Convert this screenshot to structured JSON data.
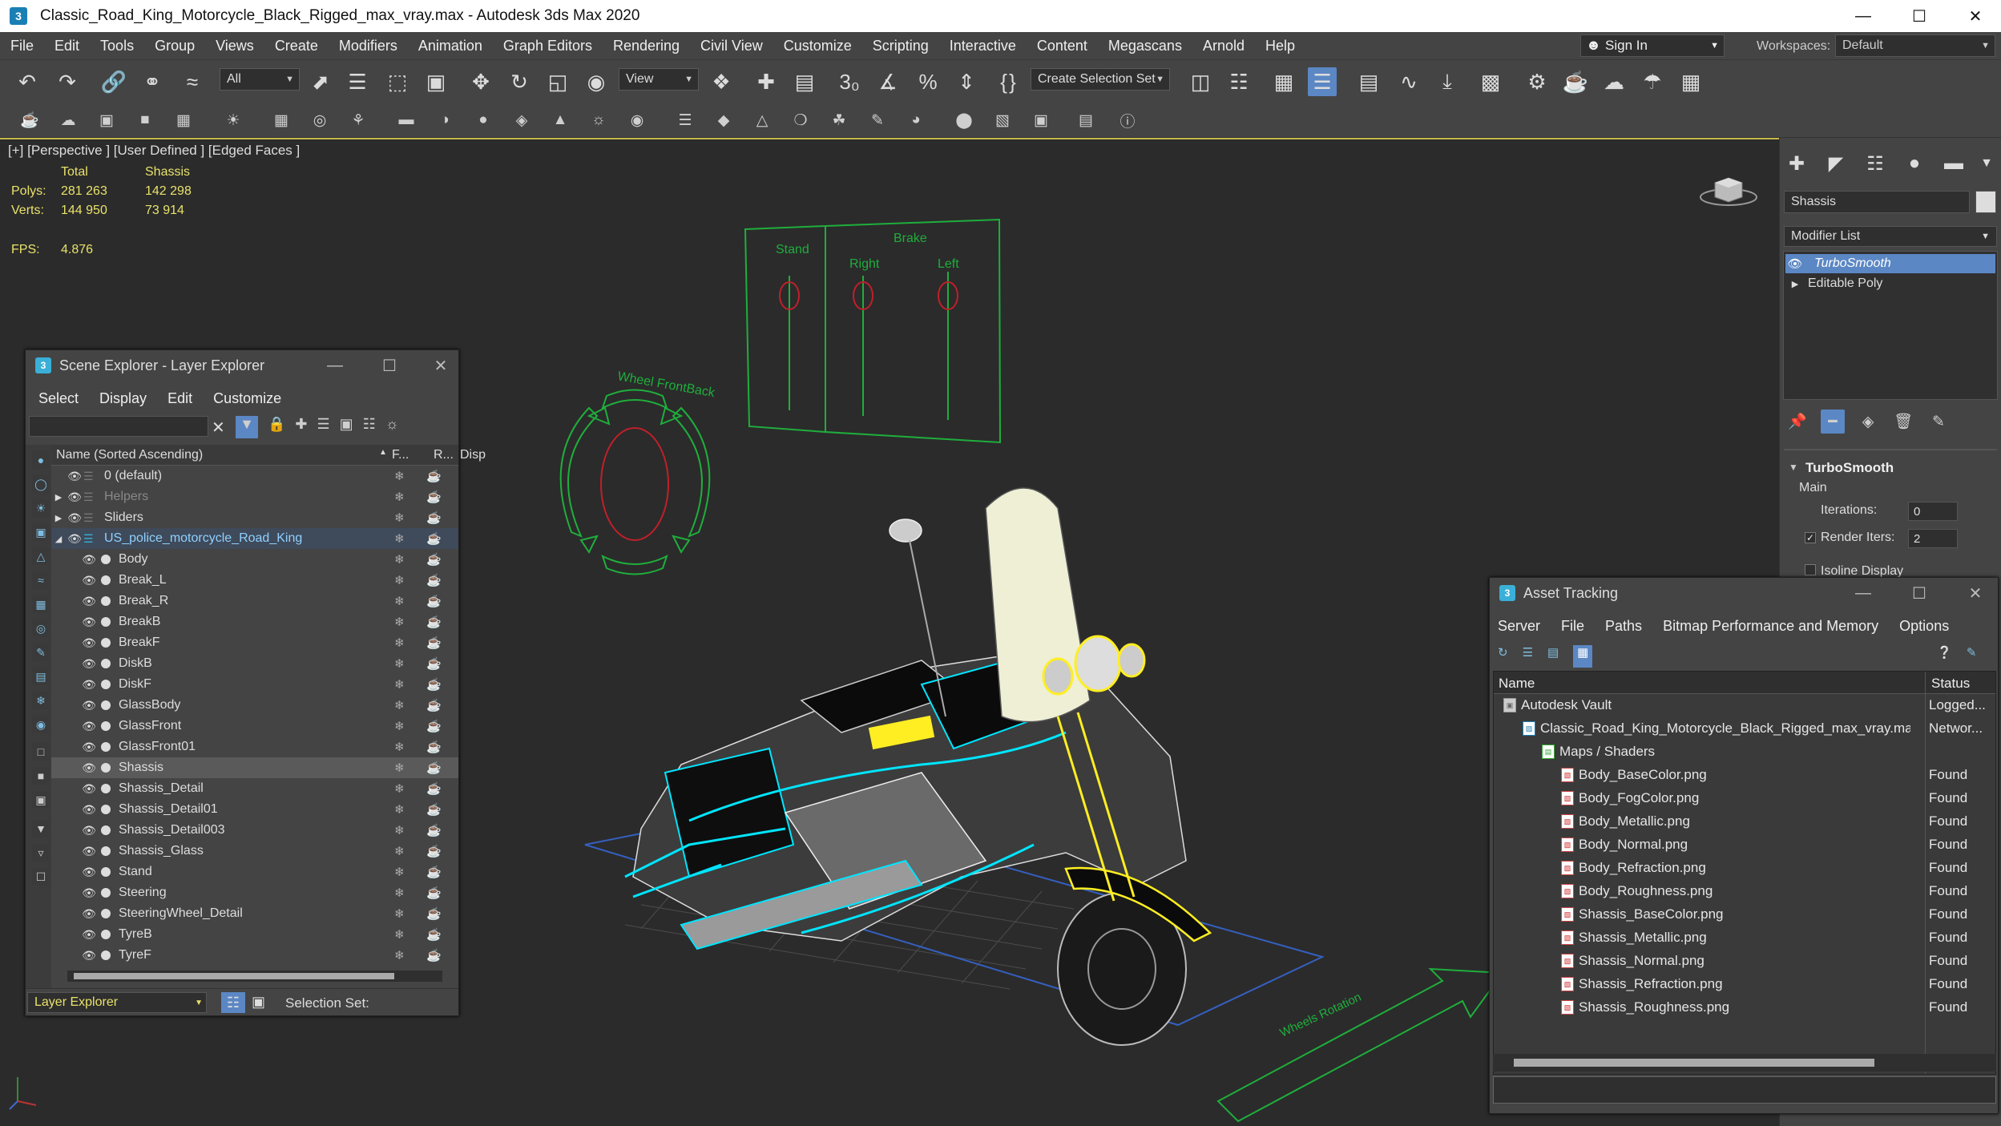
{
  "window": {
    "title": "Classic_Road_King_Motorcycle_Black_Rigged_max_vray.max - Autodesk 3ds Max 2020",
    "logo": "3"
  },
  "menu": [
    "File",
    "Edit",
    "Tools",
    "Group",
    "Views",
    "Create",
    "Modifiers",
    "Animation",
    "Graph Editors",
    "Rendering",
    "Civil View",
    "Customize",
    "Scripting",
    "Interactive",
    "Content",
    "Megascans",
    "Arnold",
    "Help"
  ],
  "signin": "Sign In",
  "workspaces": {
    "label": "Workspaces:",
    "value": "Default"
  },
  "toolbar": {
    "selection_filter": "All",
    "reference_coord": "View",
    "selection_set": "Create Selection Set"
  },
  "viewport": {
    "label": "[+] [Perspective ] [User Defined ] [Edged Faces ]",
    "stats": {
      "col_total": "Total",
      "col_selected": "Shassis",
      "polys_label": "Polys:",
      "polys_total": "281 263",
      "polys_sel": "142 298",
      "verts_label": "Verts:",
      "verts_total": "144 950",
      "verts_sel": "73 914",
      "fps_label": "FPS:",
      "fps": "4.876"
    },
    "rig_labels": {
      "wheel": "Wheel FrontBack",
      "stand": "Stand",
      "brake": "Brake",
      "right": "Right",
      "left": "Left",
      "wheels_bottom": "Wheels Rotation"
    }
  },
  "scene_explorer": {
    "title": "Scene Explorer - Layer Explorer",
    "menu": [
      "Select",
      "Display",
      "Edit",
      "Customize"
    ],
    "columns": {
      "name": "Name (Sorted Ascending)",
      "f": "F...",
      "r": "R...",
      "disp": "Disp"
    },
    "rows": [
      {
        "name": "0 (default)",
        "level": 0,
        "type": "layer"
      },
      {
        "name": "Helpers",
        "level": 0,
        "type": "layer",
        "dim": true,
        "expand": true
      },
      {
        "name": "Sliders",
        "level": 0,
        "type": "layer",
        "expand": true
      },
      {
        "name": "US_police_motorcycle_Road_King",
        "level": 0,
        "type": "layer",
        "expanded": true,
        "highlight": true
      },
      {
        "name": "Body",
        "level": 1
      },
      {
        "name": "Break_L",
        "level": 1
      },
      {
        "name": "Break_R",
        "level": 1
      },
      {
        "name": "BreakB",
        "level": 1
      },
      {
        "name": "BreakF",
        "level": 1
      },
      {
        "name": "DiskB",
        "level": 1
      },
      {
        "name": "DiskF",
        "level": 1
      },
      {
        "name": "GlassBody",
        "level": 1
      },
      {
        "name": "GlassFront",
        "level": 1
      },
      {
        "name": "GlassFront01",
        "level": 1
      },
      {
        "name": "Shassis",
        "level": 1,
        "selected": true
      },
      {
        "name": "Shassis_Detail",
        "level": 1
      },
      {
        "name": "Shassis_Detail01",
        "level": 1
      },
      {
        "name": "Shassis_Detail003",
        "level": 1
      },
      {
        "name": "Shassis_Glass",
        "level": 1
      },
      {
        "name": "Stand",
        "level": 1
      },
      {
        "name": "Steering",
        "level": 1
      },
      {
        "name": "SteeringWheel_Detail",
        "level": 1
      },
      {
        "name": "TyreB",
        "level": 1
      },
      {
        "name": "TyreF",
        "level": 1
      }
    ],
    "footer": {
      "explorer": "Layer Explorer",
      "selection_set": "Selection Set:"
    }
  },
  "command_panel": {
    "object_name": "Shassis",
    "modifier_list": "Modifier List",
    "stack": [
      {
        "name": "TurboSmooth",
        "active": true
      },
      {
        "name": "Editable Poly",
        "active": false
      }
    ],
    "rollout": {
      "title": "TurboSmooth",
      "section": "Main",
      "iterations_label": "Iterations:",
      "iterations": "0",
      "render_iters_label": "Render Iters:",
      "render_iters": "2",
      "isoline": "Isoline Display"
    }
  },
  "asset_tracking": {
    "title": "Asset Tracking",
    "menu": [
      "Server",
      "File",
      "Paths",
      "Bitmap Performance and Memory",
      "Options"
    ],
    "columns": {
      "name": "Name",
      "status": "Status"
    },
    "rows": [
      {
        "name": "Autodesk Vault",
        "status": "Logged...",
        "indent": 0,
        "kind": "vault"
      },
      {
        "name": "Classic_Road_King_Motorcycle_Black_Rigged_max_vray.max",
        "status": "Networ...",
        "indent": 1,
        "kind": "max"
      },
      {
        "name": "Maps / Shaders",
        "status": "",
        "indent": 2,
        "kind": "folder"
      },
      {
        "name": "Body_BaseColor.png",
        "status": "Found",
        "indent": 3,
        "kind": "png"
      },
      {
        "name": "Body_FogColor.png",
        "status": "Found",
        "indent": 3,
        "kind": "png"
      },
      {
        "name": "Body_Metallic.png",
        "status": "Found",
        "indent": 3,
        "kind": "png"
      },
      {
        "name": "Body_Normal.png",
        "status": "Found",
        "indent": 3,
        "kind": "png"
      },
      {
        "name": "Body_Refraction.png",
        "status": "Found",
        "indent": 3,
        "kind": "png"
      },
      {
        "name": "Body_Roughness.png",
        "status": "Found",
        "indent": 3,
        "kind": "png"
      },
      {
        "name": "Shassis_BaseColor.png",
        "status": "Found",
        "indent": 3,
        "kind": "png"
      },
      {
        "name": "Shassis_Metallic.png",
        "status": "Found",
        "indent": 3,
        "kind": "png"
      },
      {
        "name": "Shassis_Normal.png",
        "status": "Found",
        "indent": 3,
        "kind": "png"
      },
      {
        "name": "Shassis_Refraction.png",
        "status": "Found",
        "indent": 3,
        "kind": "png"
      },
      {
        "name": "Shassis_Roughness.png",
        "status": "Found",
        "indent": 3,
        "kind": "png"
      }
    ]
  },
  "colors": {
    "accent": "#5b87c4",
    "selection_wire": "#00e5ff",
    "highlight_wire": "#ffee22",
    "rig_green": "#1fae3c",
    "rig_red": "#c0202a",
    "stat_yellow": "#e8e26a"
  }
}
